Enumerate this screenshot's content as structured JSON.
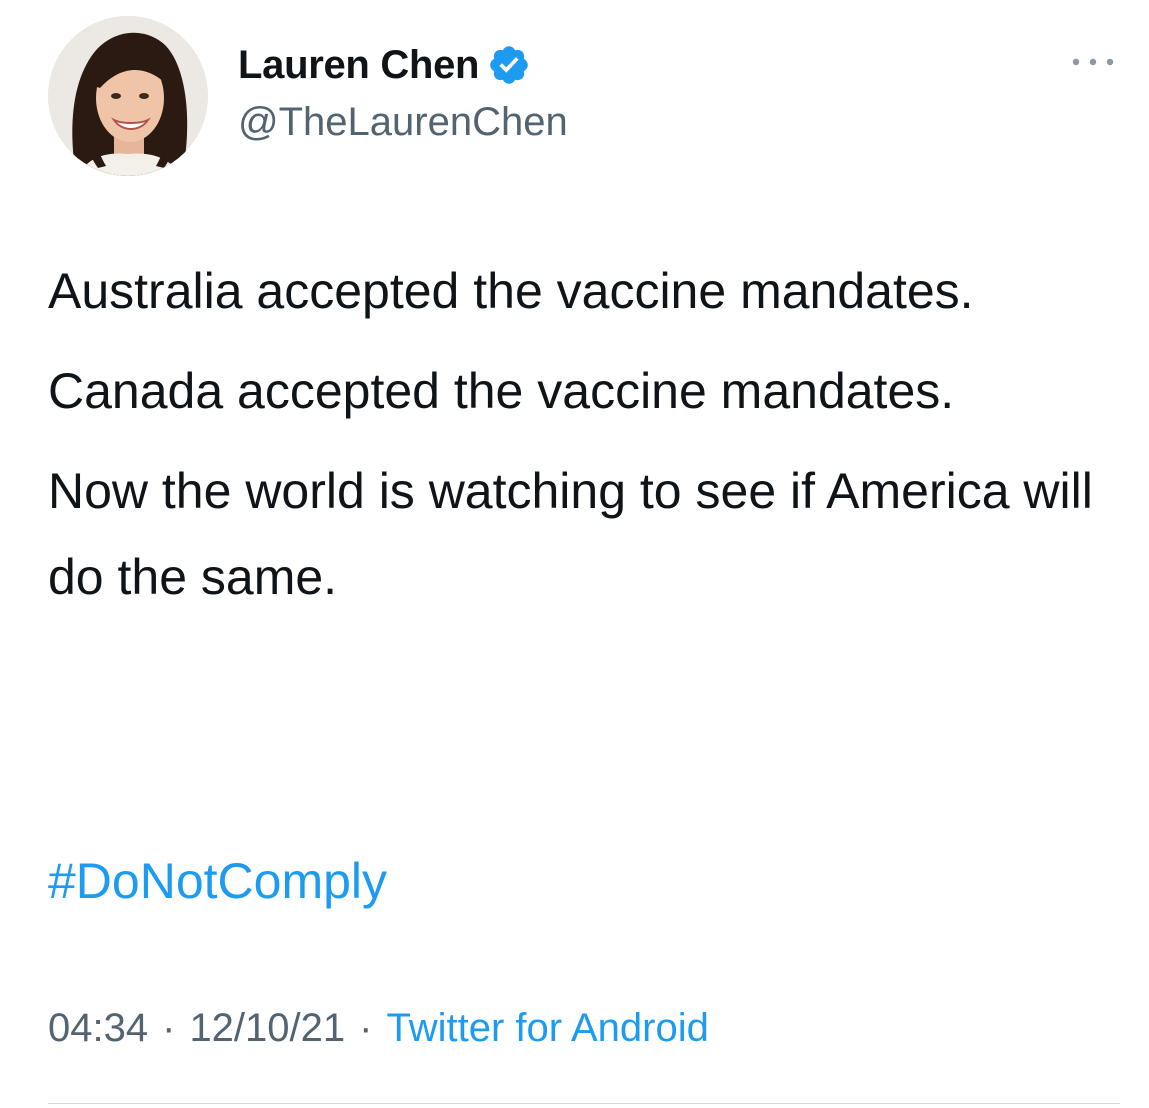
{
  "author": {
    "name": "Lauren Chen",
    "handle": "@TheLaurenChen",
    "verified_icon": "verified-badge-icon",
    "avatar_icon": "profile-photo"
  },
  "tweet": {
    "paragraphs": [
      "Australia accepted the vaccine mandates.",
      "Canada accepted the vaccine mandates.",
      "Now the world is watching to see if America will do the same."
    ],
    "hashtag": "#DoNotComply"
  },
  "meta": {
    "time": "04:34",
    "date": "12/10/21",
    "separator": "·",
    "source": "Twitter for Android"
  },
  "menu": {
    "icon": "more-options-icon"
  },
  "colors": {
    "text": "#0f1419",
    "secondary": "#536471",
    "link": "#1d9bf0",
    "verified": "#1d9bf0",
    "divider": "#cfd9de"
  }
}
